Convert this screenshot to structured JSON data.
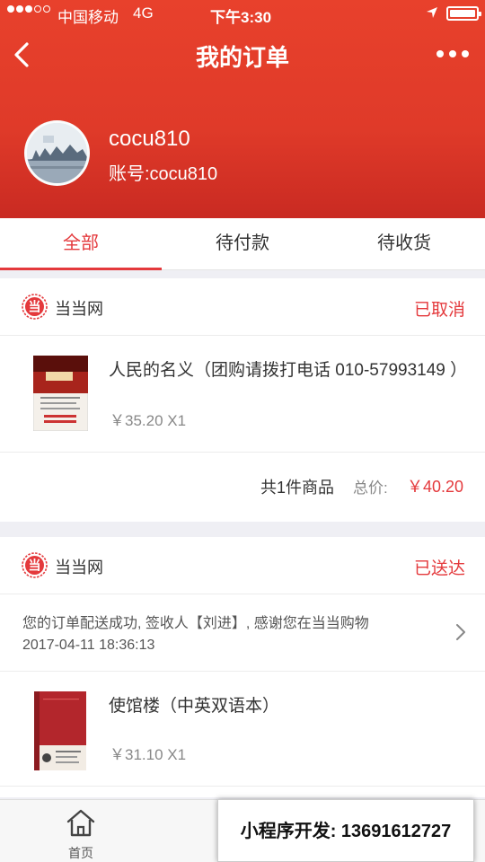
{
  "status_bar": {
    "carrier": "中国移动",
    "network": "4G",
    "time": "下午3:30"
  },
  "nav": {
    "title": "我的订单"
  },
  "profile": {
    "username": "cocu810",
    "account": "账号:cocu810"
  },
  "tabs": [
    {
      "label": "全部",
      "active": true
    },
    {
      "label": "待付款",
      "active": false
    },
    {
      "label": "待收货",
      "active": false
    }
  ],
  "orders": [
    {
      "shop_name": "当当网",
      "shop_icon_text": "当",
      "status": "已取消",
      "product": {
        "title": "人民的名义（团购请拨打电话 010-57993149 ）",
        "price": "￥35.20 X1"
      },
      "summary": {
        "count": "共1件商品",
        "total_label": "总价:",
        "total": "￥40.20"
      }
    },
    {
      "shop_name": "当当网",
      "shop_icon_text": "当",
      "status": "已送达",
      "delivery": {
        "message": "您的订单配送成功, 签收人【刘进】, 感谢您在当当购物",
        "time": "2017-04-11 18:36:13"
      },
      "product": {
        "title": "使馆楼（中英双语本）",
        "price": "￥31.10 X1"
      }
    }
  ],
  "tabbar": {
    "home_label": "首页"
  },
  "promo": {
    "text": "小程序开发: 13691612727"
  },
  "colors": {
    "brand_red": "#e4393c",
    "header_red": "#df3a29"
  }
}
